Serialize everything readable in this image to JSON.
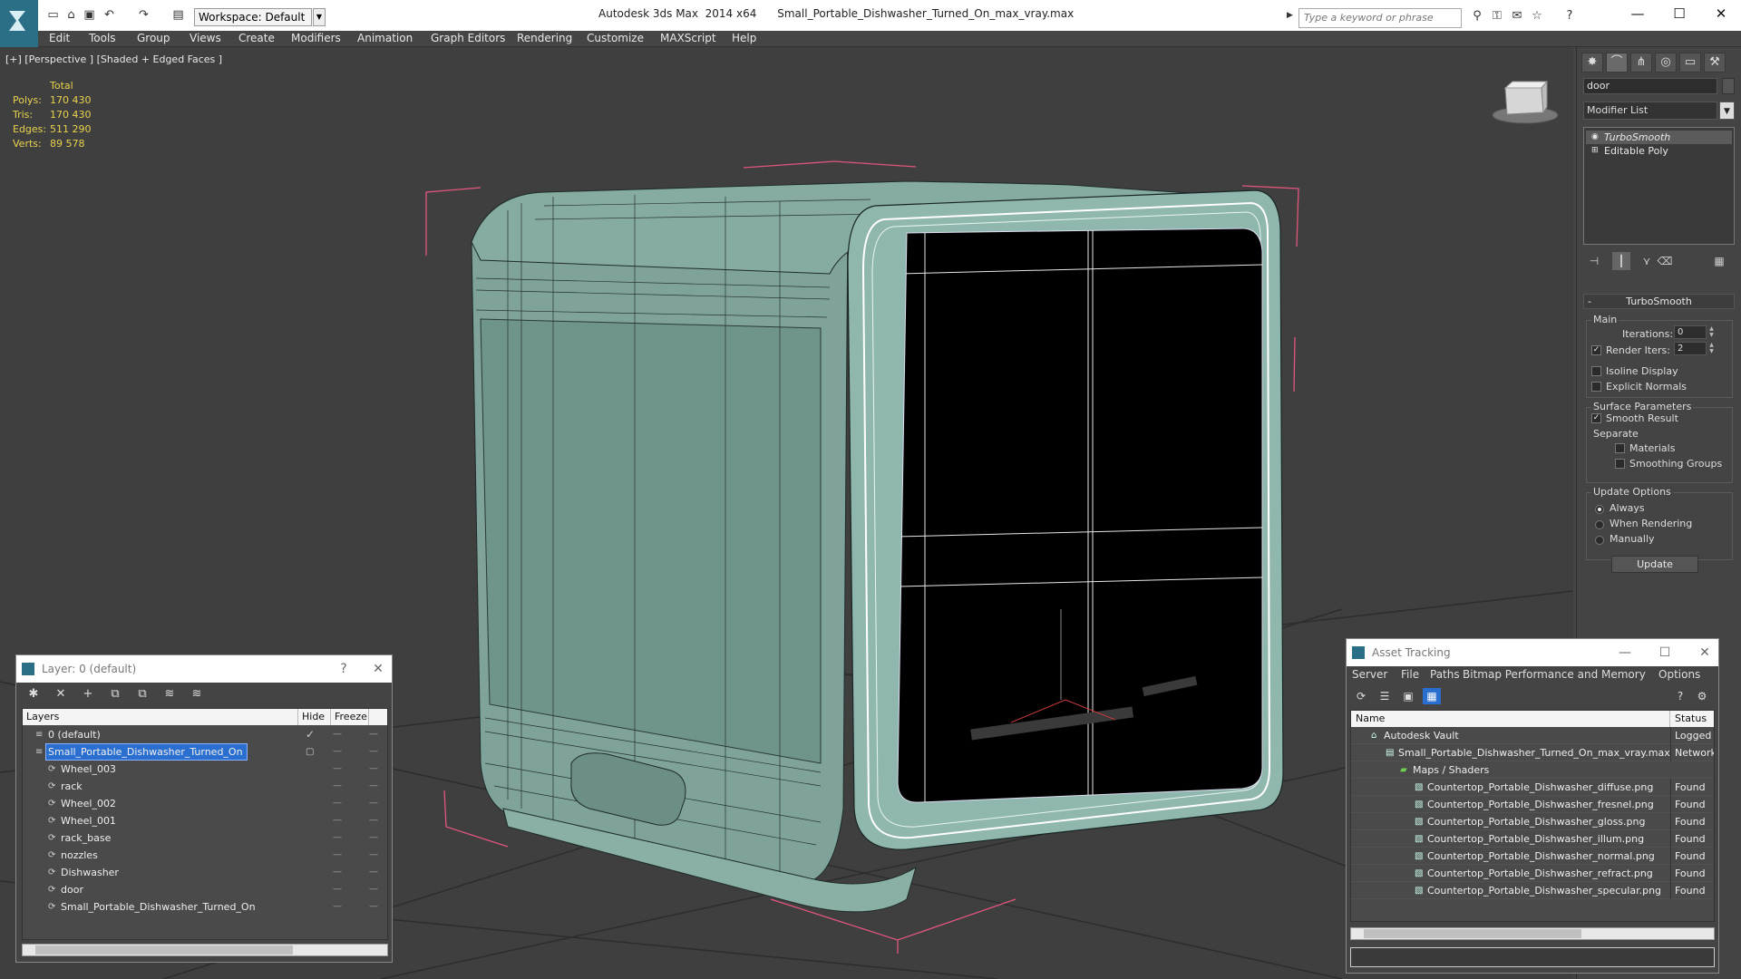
{
  "app": {
    "title": "Autodesk 3ds Max  2014 x64      Small_Portable_Dishwasher_Turned_On_max_vray.max",
    "workspace": "Workspace: Default",
    "search_placeholder": "Type a keyword or phrase"
  },
  "menu": [
    "Edit",
    "Tools",
    "Group",
    "Views",
    "Create",
    "Modifiers",
    "Animation",
    "Graph Editors",
    "Rendering",
    "Customize",
    "MAXScript",
    "Help"
  ],
  "viewport": {
    "label": "[+] [Perspective ] [Shaded + Edged Faces ]",
    "stats": {
      "header": "Total",
      "rows": [
        {
          "label": "Polys:",
          "value": "170 430"
        },
        {
          "label": "Tris:",
          "value": "170 430"
        },
        {
          "label": "Edges:",
          "value": "511 290"
        },
        {
          "label": "Verts:",
          "value": "89 578"
        }
      ]
    }
  },
  "command_panel": {
    "object_name": "door",
    "modifier_list": "Modifier List",
    "stack": [
      "TurboSmooth",
      "Editable Poly"
    ],
    "rollout_title": "TurboSmooth",
    "main_group": "Main",
    "iterations_label": "Iterations:",
    "iterations_value": "0",
    "render_iters_label": "Render Iters:",
    "render_iters_value": "2",
    "isoline_label": "Isoline Display",
    "explicit_normals_label": "Explicit Normals",
    "surface_group": "Surface Parameters",
    "smooth_result_label": "Smooth Result",
    "separate_label": "Separate",
    "materials_label": "Materials",
    "smoothing_groups_label": "Smoothing Groups",
    "update_group": "Update Options",
    "always_label": "Always",
    "when_rendering_label": "When Rendering",
    "manually_label": "Manually",
    "update_button": "Update"
  },
  "layer_window": {
    "title": "Layer: 0 (default)",
    "help": "?",
    "columns": [
      "Layers",
      "Hide",
      "Freeze"
    ],
    "rows": [
      {
        "name": "0 (default)",
        "indent": 0,
        "check": true
      },
      {
        "name": "Small_Portable_Dishwasher_Turned_On",
        "indent": 0,
        "selected": true
      },
      {
        "name": "Wheel_003",
        "indent": 1
      },
      {
        "name": "rack",
        "indent": 1
      },
      {
        "name": "Wheel_002",
        "indent": 1
      },
      {
        "name": "Wheel_001",
        "indent": 1
      },
      {
        "name": "rack_base",
        "indent": 1
      },
      {
        "name": "nozzles",
        "indent": 1
      },
      {
        "name": "Dishwasher",
        "indent": 1
      },
      {
        "name": "door",
        "indent": 1
      },
      {
        "name": "Small_Portable_Dishwasher_Turned_On",
        "indent": 1
      }
    ]
  },
  "asset_window": {
    "title": "Asset Tracking",
    "menu": [
      "Server",
      "File",
      "Paths",
      "Bitmap Performance and Memory",
      "Options"
    ],
    "columns": [
      "Name",
      "Status"
    ],
    "rows": [
      {
        "name": "Autodesk Vault",
        "status": "Logged O",
        "indent": 0
      },
      {
        "name": "Small_Portable_Dishwasher_Turned_On_max_vray.max",
        "status": "Network F",
        "indent": 1
      },
      {
        "name": "Maps / Shaders",
        "status": "",
        "indent": 2
      },
      {
        "name": "Countertop_Portable_Dishwasher_diffuse.png",
        "status": "Found",
        "indent": 3
      },
      {
        "name": "Countertop_Portable_Dishwasher_fresnel.png",
        "status": "Found",
        "indent": 3
      },
      {
        "name": "Countertop_Portable_Dishwasher_gloss.png",
        "status": "Found",
        "indent": 3
      },
      {
        "name": "Countertop_Portable_Dishwasher_illum.png",
        "status": "Found",
        "indent": 3
      },
      {
        "name": "Countertop_Portable_Dishwasher_normal.png",
        "status": "Found",
        "indent": 3
      },
      {
        "name": "Countertop_Portable_Dishwasher_refract.png",
        "status": "Found",
        "indent": 3
      },
      {
        "name": "Countertop_Portable_Dishwasher_specular.png",
        "status": "Found",
        "indent": 3
      }
    ]
  },
  "colors": {
    "model_fill": "#7fa39a",
    "bbox": "#e0567c",
    "stats_text": "#e8d24f",
    "selection": "#2a6fcf"
  }
}
